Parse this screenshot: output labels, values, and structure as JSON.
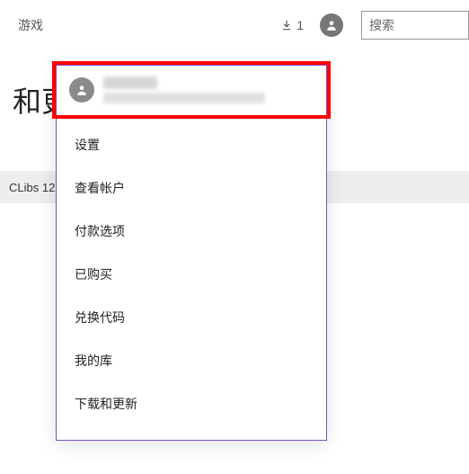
{
  "topbar": {
    "nav_label": "游戏",
    "download_count": "1",
    "search_placeholder": "搜索"
  },
  "background": {
    "heading_fragment": "和更",
    "strip_text": "CLibs 12"
  },
  "dropdown": {
    "menu": [
      {
        "label": "设置"
      },
      {
        "label": "查看帐户"
      },
      {
        "label": "付款选项"
      },
      {
        "label": "已购买"
      },
      {
        "label": "兑换代码"
      },
      {
        "label": "我的库"
      },
      {
        "label": "下载和更新"
      }
    ]
  }
}
